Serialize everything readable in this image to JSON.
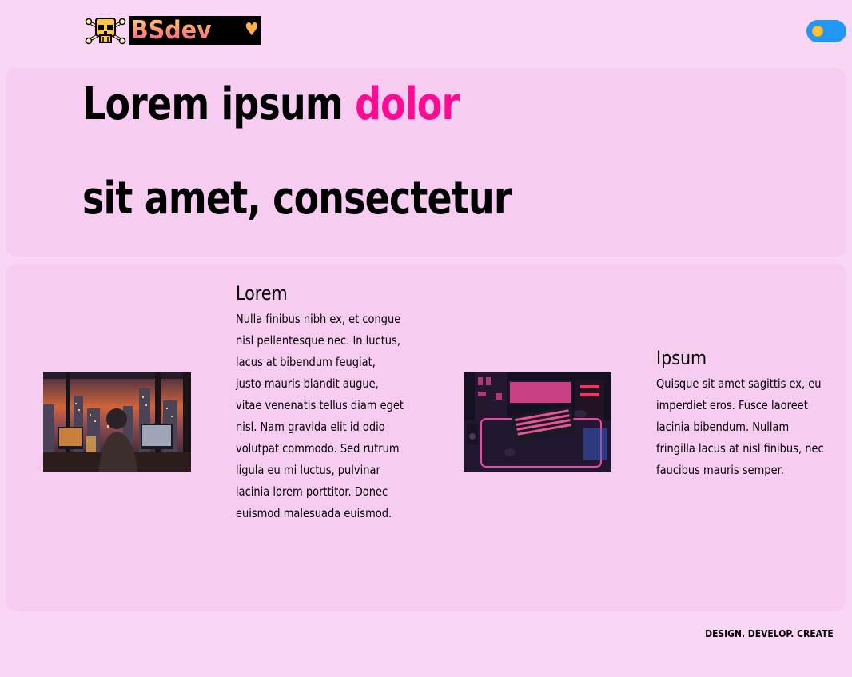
{
  "header": {
    "logo_text": "BSdev",
    "logo_icon": "skull-crossbones-icon",
    "logo_heart": "heart-icon",
    "theme_toggle": {
      "state": "light",
      "icon": "sun-icon",
      "color": "#2196f3"
    }
  },
  "hero": {
    "line1_plain": "Lorem ipsum ",
    "line1_accent": "dolor",
    "line2": "sit amet, consectetur",
    "accent_color": "#ff0a92"
  },
  "features": [
    {
      "title": "Lorem",
      "body": "Nulla finibus nibh ex, et congue nisl pellentesque nec. In luctus, lacus at bibendum feugiat, justo mauris blandit augue, vitae venenatis tellus diam eget nisl. Nam gravida elit id odio volutpat commodo. Sed rutrum ligula eu mi luctus, pulvinar lacinia lorem porttitor. Donec euismod malesuada euismod."
    },
    {
      "title": "Ipsum",
      "body": "Quisque sit amet sagittis ex, eu imperdiet eros. Fusce laoreet lacinia bibendum. Nullam fringilla lacus at nisl finibus, nec faucibus mauris semper."
    }
  ],
  "footer": {
    "tagline": "DESIGN. DEVELOP. CREATE"
  },
  "colors": {
    "page_background": "#f9d6f4",
    "card_background": "#f7ccf1"
  }
}
